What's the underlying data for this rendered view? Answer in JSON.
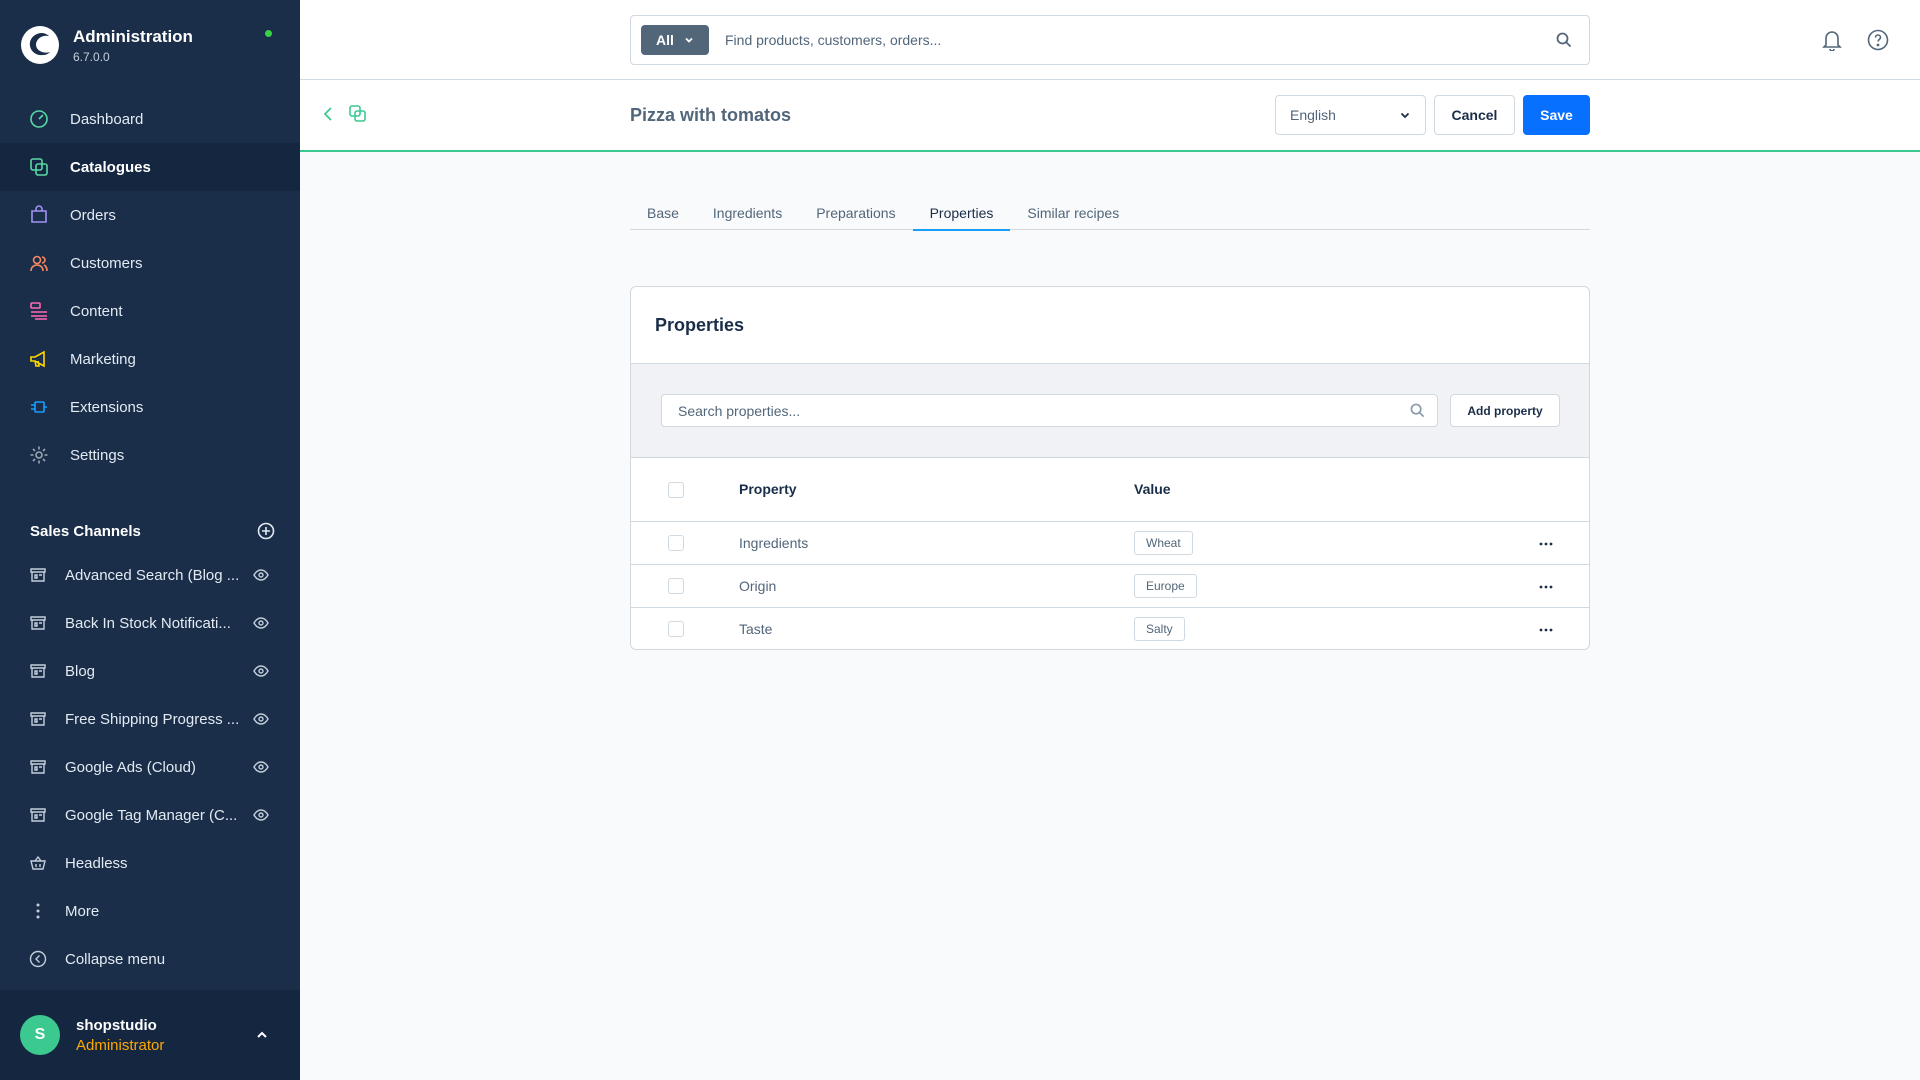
{
  "brand": {
    "title": "Administration",
    "version": "6.7.0.0"
  },
  "nav": [
    {
      "label": "Dashboard",
      "icon": "dashboard-icon",
      "color": "#57d9a3"
    },
    {
      "label": "Catalogues",
      "icon": "catalogue-icon",
      "color": "#57d9a3",
      "active": true
    },
    {
      "label": "Orders",
      "icon": "orders-icon",
      "color": "#a092f0"
    },
    {
      "label": "Customers",
      "icon": "customers-icon",
      "color": "#f88962"
    },
    {
      "label": "Content",
      "icon": "content-icon",
      "color": "#ff68b4"
    },
    {
      "label": "Marketing",
      "icon": "marketing-icon",
      "color": "#ffd700"
    },
    {
      "label": "Extensions",
      "icon": "extensions-icon",
      "color": "#189eff"
    },
    {
      "label": "Settings",
      "icon": "settings-icon",
      "color": "#9aa8b5"
    }
  ],
  "sales_channels": {
    "title": "Sales Channels",
    "items": [
      {
        "label": "Advanced Search (Blog ..."
      },
      {
        "label": "Back In Stock Notificati..."
      },
      {
        "label": "Blog"
      },
      {
        "label": "Free Shipping Progress ..."
      },
      {
        "label": "Google Ads (Cloud)"
      },
      {
        "label": "Google Tag Manager (C..."
      },
      {
        "label": "Headless"
      }
    ],
    "more_label": "More",
    "collapse_label": "Collapse menu"
  },
  "user": {
    "initial": "S",
    "name": "shopstudio",
    "role": "Administrator"
  },
  "search": {
    "type": "All",
    "placeholder": "Find products, customers, orders..."
  },
  "page": {
    "title": "Pizza with tomatos",
    "language": "English",
    "cancel": "Cancel",
    "save": "Save"
  },
  "tabs": [
    "Base",
    "Ingredients",
    "Preparations",
    "Properties",
    "Similar recipes"
  ],
  "active_tab": "Properties",
  "card": {
    "title": "Properties",
    "search_placeholder": "Search properties...",
    "add_label": "Add property",
    "columns": {
      "property": "Property",
      "value": "Value"
    },
    "rows": [
      {
        "property": "Ingredients",
        "value": "Wheat"
      },
      {
        "property": "Origin",
        "value": "Europe"
      },
      {
        "property": "Taste",
        "value": "Salty"
      }
    ]
  },
  "colors": {
    "sidebar": "#1a2e49",
    "accent": "#0870ff",
    "success": "#3cc98f",
    "role": "#ffa900"
  }
}
